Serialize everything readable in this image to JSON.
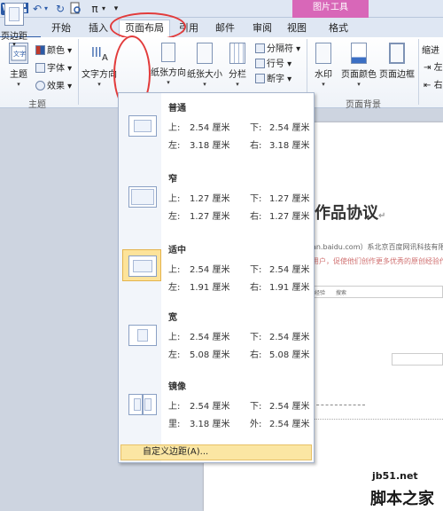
{
  "quick_access": {
    "word_icon": "W",
    "save_icon": "floppy-disk",
    "undo_icon": "undo-arrow",
    "redo_icon": "redo-arrow",
    "preview_icon": "print-preview",
    "pi_label": "π"
  },
  "context_tab_header": "图片工具",
  "tabs": {
    "file": "文件",
    "start": "开始",
    "insert": "插入",
    "page_layout": "页面布局",
    "references": "引用",
    "mailings": "邮件",
    "review": "审阅",
    "view": "视图",
    "format": "格式"
  },
  "ribbon": {
    "theme": {
      "label": "主题",
      "colors": "颜色",
      "fonts": "字体",
      "effects": "效果",
      "group": "主题"
    },
    "page_setup": {
      "text_direction": "文字方向",
      "margins": "页边距",
      "orientation": "纸张方向",
      "size": "纸张大小",
      "columns": "分栏",
      "breaks": "分隔符",
      "line_numbers": "行号",
      "hyphenation": "断字"
    },
    "page_background": {
      "watermark": "水印",
      "page_color": "页面颜色",
      "page_borders": "页面边框",
      "group": "页面背景"
    },
    "indent": {
      "label": "缩进",
      "left": "左",
      "right": "右"
    }
  },
  "margins_menu": {
    "options": [
      {
        "name": "普通",
        "r1": [
          "上:",
          "2.54 厘米",
          "下:",
          "2.54 厘米"
        ],
        "r2": [
          "左:",
          "3.18 厘米",
          "右:",
          "3.18 厘米"
        ]
      },
      {
        "name": "窄",
        "r1": [
          "上:",
          "1.27 厘米",
          "下:",
          "1.27 厘米"
        ],
        "r2": [
          "左:",
          "1.27 厘米",
          "右:",
          "1.27 厘米"
        ]
      },
      {
        "name": "适中",
        "r1": [
          "上:",
          "2.54 厘米",
          "下:",
          "2.54 厘米"
        ],
        "r2": [
          "左:",
          "1.91 厘米",
          "右:",
          "1.91 厘米"
        ]
      },
      {
        "name": "宽",
        "r1": [
          "上:",
          "2.54 厘米",
          "下:",
          "2.54 厘米"
        ],
        "r2": [
          "左:",
          "5.08 厘米",
          "右:",
          "5.08 厘米"
        ]
      },
      {
        "name": "镜像",
        "r1": [
          "上:",
          "2.54 厘米",
          "下:",
          "2.54 厘米"
        ],
        "r2": [
          "里:",
          "3.18 厘米",
          "外:",
          "2.54 厘米"
        ]
      }
    ],
    "custom": "自定义边距(A)..."
  },
  "document": {
    "title": "作品协议",
    "line1": "an.baidu.com）系北京百度网讯科技有限公",
    "line2": "用户，促使他们创作更多优秀的原创经验作",
    "box_items": [
      "经验",
      "搜索"
    ]
  },
  "watermark": {
    "line1": "jb51.net",
    "line2": "脚本之家"
  }
}
